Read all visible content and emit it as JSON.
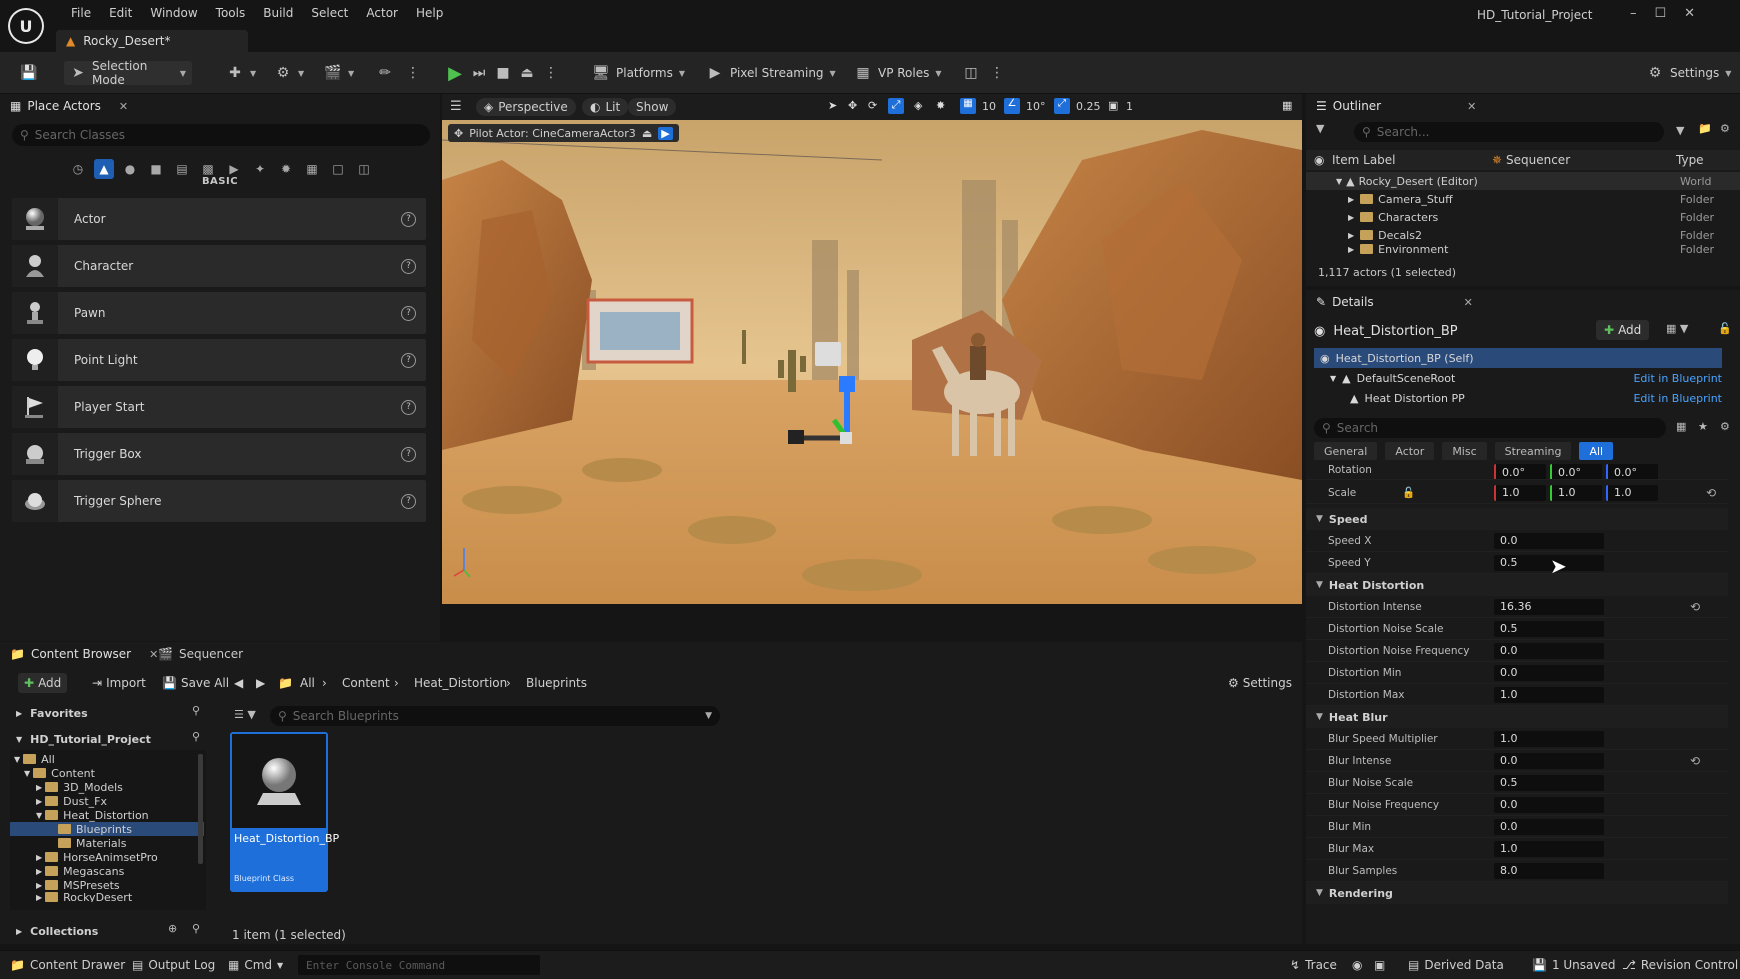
{
  "app": {
    "project_title": "HD_Tutorial_Project",
    "level_tab": "Rocky_Desert*",
    "menu": [
      "File",
      "Edit",
      "Window",
      "Tools",
      "Build",
      "Select",
      "Actor",
      "Help"
    ]
  },
  "toolbar": {
    "selection_mode": "Selection Mode",
    "platforms": "Platforms",
    "pixel_streaming": "Pixel Streaming",
    "vp_roles": "VP Roles",
    "settings": "Settings"
  },
  "place_actors": {
    "tab_label": "Place Actors",
    "search_placeholder": "Search Classes",
    "category_title": "BASIC",
    "items": [
      {
        "label": "Actor"
      },
      {
        "label": "Character"
      },
      {
        "label": "Pawn"
      },
      {
        "label": "Point Light"
      },
      {
        "label": "Player Start"
      },
      {
        "label": "Trigger Box"
      },
      {
        "label": "Trigger Sphere"
      }
    ]
  },
  "viewport": {
    "perspective": "Perspective",
    "lit": "Lit",
    "show": "Show",
    "grid_snap": "10",
    "rot_snap": "10°",
    "scale_snap": "0.25",
    "camera_speed": "1",
    "pilot_label": "Pilot Actor: CineCameraActor3"
  },
  "outliner": {
    "tab_label": "Outliner",
    "search_placeholder": "Search...",
    "col_label": "Item Label",
    "col_sequencer": "Sequencer",
    "col_type": "Type",
    "rows": [
      {
        "label": "Rocky_Desert (Editor)",
        "type": "World"
      },
      {
        "label": "Camera_Stuff",
        "type": "Folder"
      },
      {
        "label": "Characters",
        "type": "Folder"
      },
      {
        "label": "Decals2",
        "type": "Folder"
      },
      {
        "label": "Environment",
        "type": "Folder"
      }
    ],
    "count": "1,117 actors (1 selected)"
  },
  "details": {
    "tab_label": "Details",
    "actor_name": "Heat_Distortion_BP",
    "add_label": "Add",
    "components": [
      {
        "label": "Heat_Distortion_BP (Self)",
        "link": ""
      },
      {
        "label": "DefaultSceneRoot",
        "link": "Edit in Blueprint"
      },
      {
        "label": "Heat Distortion PP",
        "link": "Edit in Blueprint"
      }
    ],
    "search_placeholder": "Search",
    "tabs": [
      "General",
      "Actor",
      "Misc",
      "Streaming",
      "All"
    ],
    "transform": {
      "rotation_label": "Rotation",
      "rotation": [
        "0.0°",
        "0.0°",
        "0.0°"
      ],
      "scale_label": "Scale",
      "scale": [
        "1.0",
        "1.0",
        "1.0"
      ]
    },
    "speed": {
      "title": "Speed",
      "props": [
        {
          "label": "Speed X",
          "value": "0.0"
        },
        {
          "label": "Speed Y",
          "value": "0.5"
        }
      ]
    },
    "heat_distortion": {
      "title": "Heat Distortion",
      "props": [
        {
          "label": "Distortion Intense",
          "value": "16.36"
        },
        {
          "label": "Distortion Noise Scale",
          "value": "0.5"
        },
        {
          "label": "Distortion Noise Frequency",
          "value": "0.0"
        },
        {
          "label": "Distortion Min",
          "value": "0.0"
        },
        {
          "label": "Distortion Max",
          "value": "1.0"
        }
      ]
    },
    "heat_blur": {
      "title": "Heat Blur",
      "props": [
        {
          "label": "Blur Speed Multiplier",
          "value": "1.0"
        },
        {
          "label": "Blur Intense",
          "value": "0.0"
        },
        {
          "label": "Blur Noise Scale",
          "value": "0.5"
        },
        {
          "label": "Blur Noise Frequency",
          "value": "0.0"
        },
        {
          "label": "Blur Min",
          "value": "0.0"
        },
        {
          "label": "Blur Max",
          "value": "1.0"
        },
        {
          "label": "Blur Samples",
          "value": "8.0"
        }
      ]
    },
    "rendering_title": "Rendering"
  },
  "content_browser": {
    "tab_label": "Content Browser",
    "sequencer_tab": "Sequencer",
    "add": "Add",
    "import": "Import",
    "save_all": "Save All",
    "crumbs": [
      "All",
      "Content",
      "Heat_Distortion",
      "Blueprints"
    ],
    "settings": "Settings",
    "favorites": "Favorites",
    "project": "HD_Tutorial_Project",
    "collections": "Collections",
    "tree": [
      "All",
      "Content",
      "3D_Models",
      "Dust_Fx",
      "Heat_Distortion",
      "Blueprints",
      "Materials",
      "HorseAnimsetPro",
      "Megascans",
      "MSPresets",
      "RockyDesert"
    ],
    "search_placeholder": "Search Blueprints",
    "asset_name": "Heat_Distortion_BP",
    "asset_type": "Blueprint Class",
    "status": "1 item (1 selected)"
  },
  "statusbar": {
    "content_drawer": "Content Drawer",
    "output_log": "Output Log",
    "cmd": "Cmd",
    "console_placeholder": "Enter Console Command",
    "trace": "Trace",
    "derived_data": "Derived Data",
    "unsaved": "1 Unsaved",
    "revision_control": "Revision Control"
  }
}
